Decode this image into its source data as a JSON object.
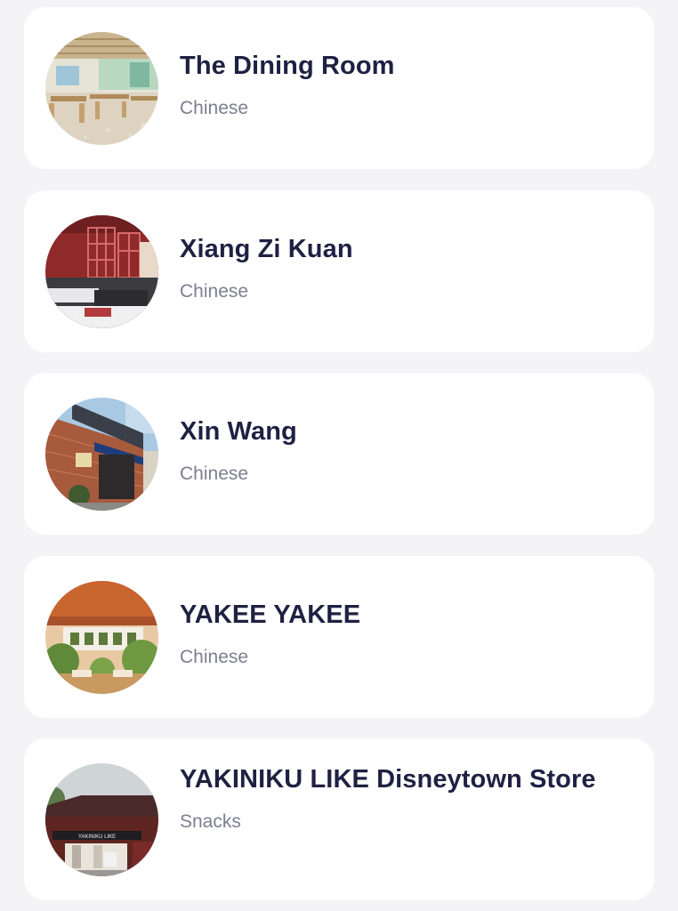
{
  "restaurants": [
    {
      "name": "The Dining Room",
      "category": "Chinese",
      "image": "dining-room-interior-photo"
    },
    {
      "name": "Xiang Zi Kuan",
      "category": "Chinese",
      "image": "red-lattice-interior-photo"
    },
    {
      "name": "Xin Wang",
      "category": "Chinese",
      "image": "brick-storefront-photo"
    },
    {
      "name": "YAKEE YAKEE",
      "category": "Chinese",
      "image": "tropical-dining-interior-photo"
    },
    {
      "name": "YAKINIKU LIKE Disneytown Store",
      "category": "Snacks",
      "image": "yakiniku-storefront-photo",
      "sign_text": "YAKINIKU LIKE"
    }
  ],
  "colors": {
    "background": "#f4f4f7",
    "card": "#ffffff",
    "title": "#1f2143",
    "subtitle": "#7c7f8f"
  }
}
